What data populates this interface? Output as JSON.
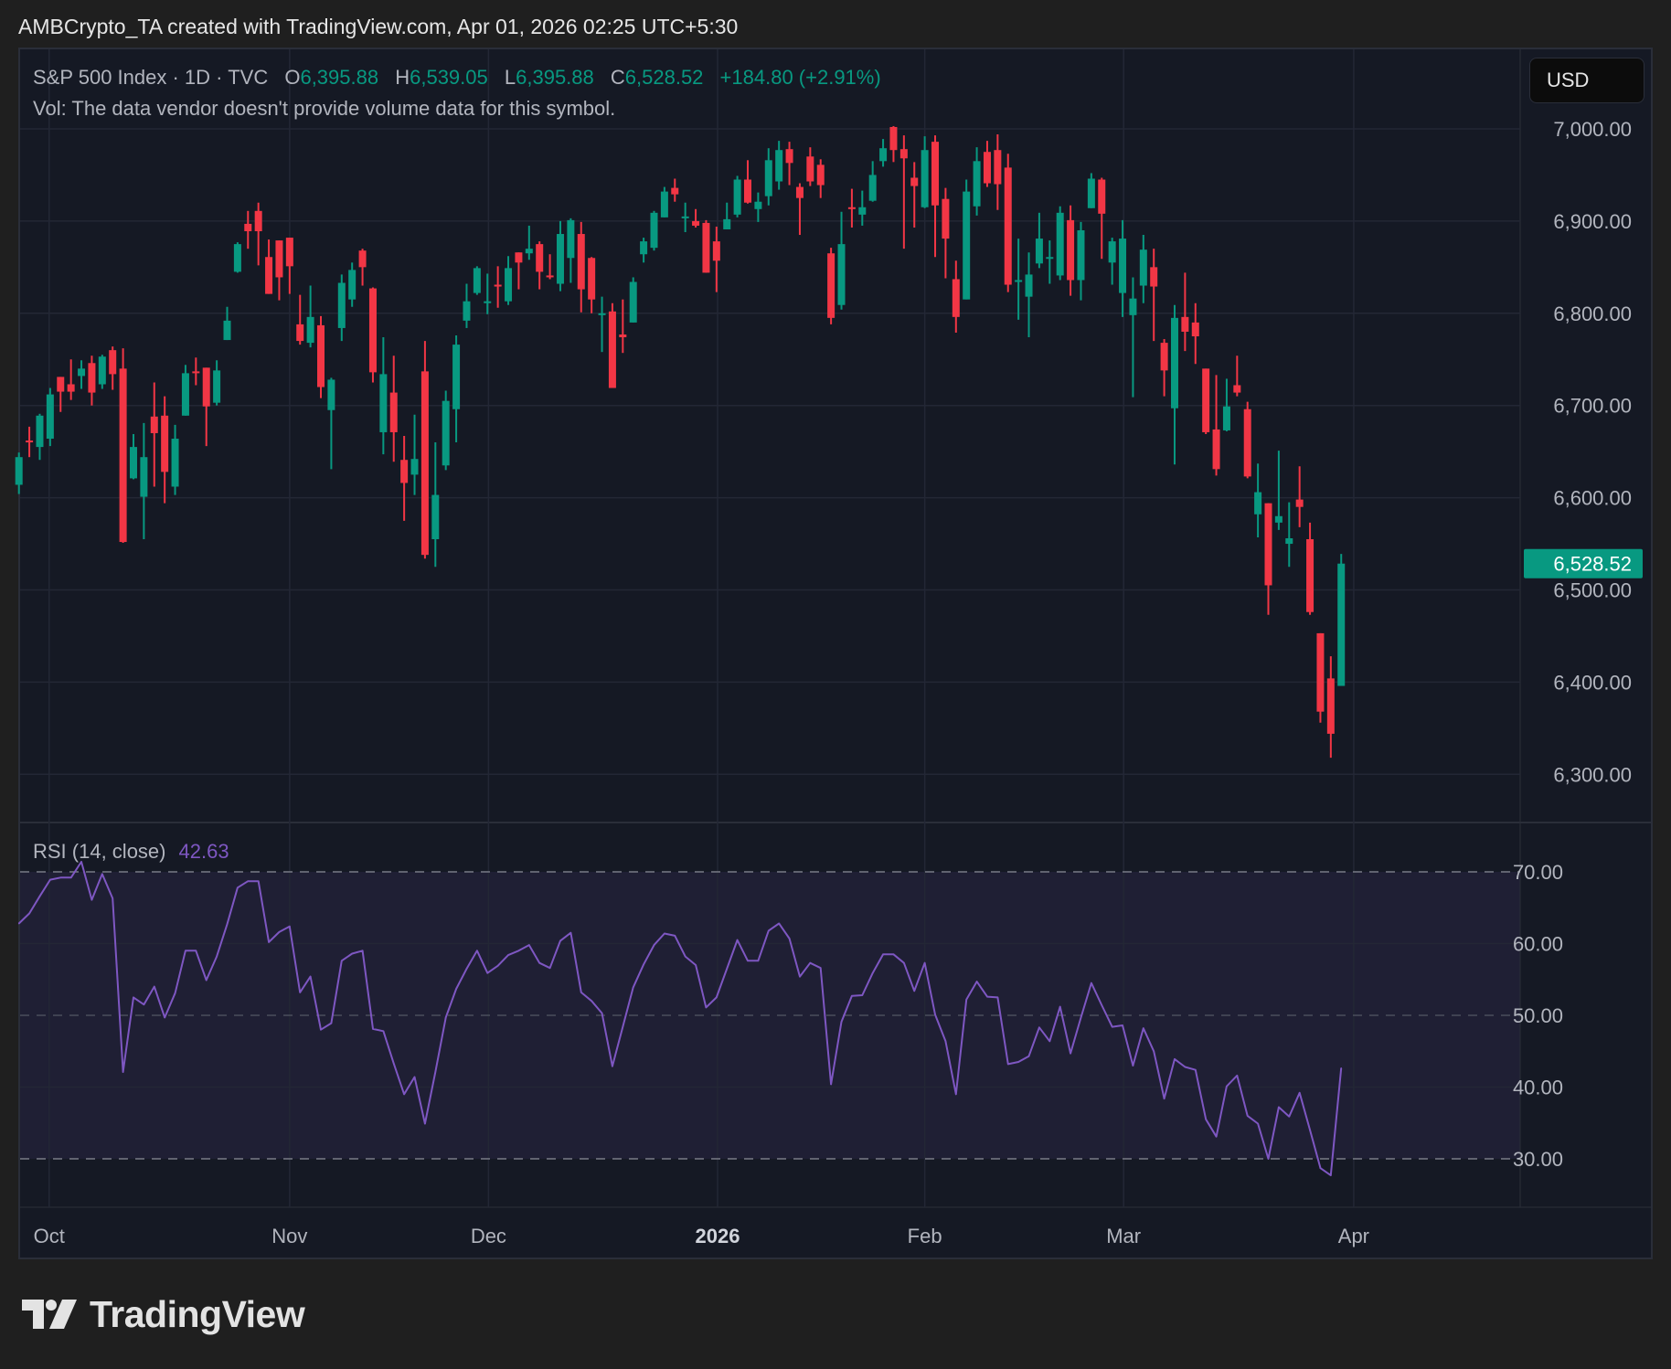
{
  "attribution": "AMBCrypto_TA created with TradingView.com, Apr 01, 2026 02:25 UTC+5:30",
  "legend": {
    "symbol": "S&P 500 Index · 1D · TVC",
    "o_label": "O",
    "o_value": "6,395.88",
    "h_label": "H",
    "h_value": "6,539.05",
    "l_label": "L",
    "l_value": "6,395.88",
    "c_label": "C",
    "c_value": "6,528.52",
    "change": "+184.80 (+2.91%)",
    "volume_note": "Vol: The data vendor doesn't provide volume data for this symbol."
  },
  "currency_button": "USD",
  "rsi_legend": {
    "label": "RSI (14, close)",
    "value": "42.63"
  },
  "logo_text": "TradingView",
  "colors": {
    "up": "#089981",
    "down": "#f23645",
    "rsi": "#7e57c2",
    "text": "#b2b5be",
    "grid": "#232735"
  },
  "chart_data": [
    {
      "type": "candlestick",
      "title": "S&P 500 Index · 1D · TVC",
      "ohlc_fields": [
        "open",
        "high",
        "low",
        "close"
      ],
      "ylim": [
        6250,
        7050
      ],
      "y_ticks": [
        7000,
        6900,
        6800,
        6700,
        6600,
        6500,
        6400,
        6300
      ],
      "y_tick_labels": [
        "7,000.00",
        "6,900.00",
        "6,800.00",
        "6,700.00",
        "6,600.00",
        "6,500.00",
        "6,400.00",
        "6,300.00"
      ],
      "last_price": 6528.52,
      "last_price_label": "6,528.52",
      "x_ticks": [
        {
          "label": "Oct",
          "at_bar": 2.9,
          "bold": false
        },
        {
          "label": "Nov",
          "at_bar": 26.0,
          "bold": false
        },
        {
          "label": "Dec",
          "at_bar": 45.1,
          "bold": false
        },
        {
          "label": "2026",
          "at_bar": 67.1,
          "bold": true
        },
        {
          "label": "Feb",
          "at_bar": 87.0,
          "bold": false
        },
        {
          "label": "Mar",
          "at_bar": 106.1,
          "bold": false
        },
        {
          "label": "Apr",
          "at_bar": 128.2,
          "bold": false
        }
      ],
      "candles": [
        [
          6614,
          6649,
          6604,
          6644
        ],
        [
          6662,
          6677,
          6644,
          6660
        ],
        [
          6655,
          6691,
          6641,
          6689
        ],
        [
          6664,
          6719,
          6656,
          6712
        ],
        [
          6731,
          6731,
          6693,
          6715
        ],
        [
          6723,
          6750,
          6706,
          6715
        ],
        [
          6732,
          6749,
          6718,
          6740
        ],
        [
          6746,
          6754,
          6700,
          6714
        ],
        [
          6723,
          6755,
          6718,
          6753
        ],
        [
          6760,
          6764,
          6717,
          6734
        ],
        [
          6740,
          6762,
          6551,
          6552
        ],
        [
          6621,
          6669,
          6620,
          6655
        ],
        [
          6601,
          6681,
          6555,
          6644
        ],
        [
          6688,
          6725,
          6612,
          6670
        ],
        [
          6689,
          6710,
          6594,
          6628
        ],
        [
          6612,
          6679,
          6603,
          6664
        ],
        [
          6689,
          6744,
          6689,
          6735
        ],
        [
          6737,
          6752,
          6722,
          6735
        ],
        [
          6741,
          6741,
          6656,
          6699
        ],
        [
          6703,
          6749,
          6700,
          6738
        ],
        [
          6771,
          6807,
          6771,
          6792
        ],
        [
          6845,
          6877,
          6844,
          6875
        ],
        [
          6897,
          6911,
          6870,
          6889
        ],
        [
          6911,
          6920,
          6852,
          6889
        ],
        [
          6861,
          6880,
          6821,
          6821
        ],
        [
          6879,
          6879,
          6814,
          6839
        ],
        [
          6882,
          6882,
          6821,
          6851
        ],
        [
          6788,
          6820,
          6766,
          6770
        ],
        [
          6768,
          6830,
          6763,
          6796
        ],
        [
          6787,
          6797,
          6708,
          6720
        ],
        [
          6695,
          6730,
          6631,
          6728
        ],
        [
          6784,
          6842,
          6770,
          6833
        ],
        [
          6815,
          6855,
          6807,
          6847
        ],
        [
          6868,
          6870,
          6830,
          6850
        ],
        [
          6827,
          6828,
          6725,
          6736
        ],
        [
          6671,
          6774,
          6647,
          6734
        ],
        [
          6714,
          6754,
          6639,
          6671
        ],
        [
          6641,
          6667,
          6575,
          6616
        ],
        [
          6625,
          6690,
          6603,
          6642
        ],
        [
          6737,
          6770,
          6534,
          6538
        ],
        [
          6555,
          6660,
          6525,
          6603
        ],
        [
          6635,
          6716,
          6630,
          6705
        ],
        [
          6696,
          6776,
          6660,
          6766
        ],
        [
          6792,
          6832,
          6784,
          6813
        ],
        [
          6822,
          6851,
          6820,
          6849
        ],
        [
          6811,
          6843,
          6799,
          6813
        ],
        [
          6831,
          6851,
          6806,
          6829
        ],
        [
          6813,
          6862,
          6809,
          6849
        ],
        [
          6866,
          6866,
          6826,
          6855
        ],
        [
          6865,
          6895,
          6858,
          6870
        ],
        [
          6875,
          6878,
          6826,
          6845
        ],
        [
          6841,
          6864,
          6837,
          6839
        ],
        [
          6832,
          6900,
          6824,
          6886
        ],
        [
          6860,
          6903,
          6833,
          6901
        ],
        [
          6886,
          6899,
          6801,
          6826
        ],
        [
          6860,
          6861,
          6800,
          6815
        ],
        [
          6798,
          6818,
          6758,
          6800
        ],
        [
          6802,
          6811,
          6719,
          6719
        ],
        [
          6777,
          6815,
          6757,
          6774
        ],
        [
          6790,
          6839,
          6790,
          6834
        ],
        [
          6864,
          6882,
          6855,
          6878
        ],
        [
          6871,
          6911,
          6868,
          6909
        ],
        [
          6904,
          6937,
          6904,
          6932
        ],
        [
          6936,
          6946,
          6921,
          6929
        ],
        [
          6903,
          6920,
          6888,
          6905
        ],
        [
          6900,
          6913,
          6893,
          6895
        ],
        [
          6898,
          6901,
          6844,
          6844
        ],
        [
          6878,
          6894,
          6823,
          6857
        ],
        [
          6891,
          6920,
          6891,
          6902
        ],
        [
          6907,
          6949,
          6904,
          6945
        ],
        [
          6945,
          6966,
          6919,
          6920
        ],
        [
          6913,
          6931,
          6899,
          6921
        ],
        [
          6927,
          6979,
          6917,
          6966
        ],
        [
          6943,
          6987,
          6934,
          6977
        ],
        [
          6978,
          6986,
          6939,
          6963
        ],
        [
          6937,
          6941,
          6885,
          6925
        ],
        [
          6970,
          6980,
          6938,
          6943
        ],
        [
          6961,
          6967,
          6925,
          6939
        ],
        [
          6865,
          6871,
          6788,
          6795
        ],
        [
          6809,
          6910,
          6804,
          6875
        ],
        [
          6915,
          6935,
          6893,
          6913
        ],
        [
          6907,
          6933,
          6895,
          6915
        ],
        [
          6922,
          6965,
          6921,
          6950
        ],
        [
          6965,
          6989,
          6959,
          6979
        ],
        [
          7002,
          7003,
          6964,
          6977
        ],
        [
          6978,
          6993,
          6870,
          6968
        ],
        [
          6947,
          6964,
          6893,
          6938
        ],
        [
          6915,
          6992,
          6914,
          6977
        ],
        [
          6986,
          6993,
          6861,
          6917
        ],
        [
          6924,
          6936,
          6838,
          6881
        ],
        [
          6837,
          6857,
          6779,
          6796
        ],
        [
          6815,
          6945,
          6815,
          6932
        ],
        [
          6916,
          6980,
          6906,
          6965
        ],
        [
          6975,
          6987,
          6937,
          6941
        ],
        [
          6977,
          6994,
          6912,
          6940
        ],
        [
          6958,
          6973,
          6823,
          6831
        ],
        [
          6834,
          6881,
          6793,
          6836
        ],
        [
          6818,
          6866,
          6774,
          6842
        ],
        [
          6854,
          6909,
          6849,
          6881
        ],
        [
          6860,
          6879,
          6832,
          6861
        ],
        [
          6841,
          6916,
          6836,
          6909
        ],
        [
          6901,
          6917,
          6819,
          6836
        ],
        [
          6836,
          6899,
          6814,
          6890
        ],
        [
          6914,
          6952,
          6914,
          6946
        ],
        [
          6945,
          6947,
          6859,
          6908
        ],
        [
          6855,
          6882,
          6831,
          6878
        ],
        [
          6822,
          6901,
          6796,
          6881
        ],
        [
          6798,
          6839,
          6709,
          6816
        ],
        [
          6830,
          6885,
          6811,
          6869
        ],
        [
          6850,
          6870,
          6770,
          6829
        ],
        [
          6768,
          6772,
          6710,
          6738
        ],
        [
          6697,
          6809,
          6636,
          6795
        ],
        [
          6796,
          6844,
          6759,
          6780
        ],
        [
          6790,
          6811,
          6745,
          6775
        ],
        [
          6740,
          6740,
          6669,
          6671
        ],
        [
          6674,
          6733,
          6624,
          6631
        ],
        [
          6673,
          6729,
          6672,
          6699
        ],
        [
          6722,
          6754,
          6710,
          6714
        ],
        [
          6696,
          6704,
          6621,
          6623
        ],
        [
          6582,
          6637,
          6557,
          6606
        ],
        [
          6594,
          6594,
          6473,
          6505
        ],
        [
          6573,
          6651,
          6565,
          6580
        ],
        [
          6550,
          6595,
          6525,
          6556
        ],
        [
          6598,
          6634,
          6568,
          6590
        ],
        [
          6555,
          6573,
          6473,
          6476
        ],
        [
          6453,
          6453,
          6356,
          6368
        ],
        [
          6404,
          6428,
          6318,
          6344
        ],
        [
          6395.88,
          6539.05,
          6395.88,
          6528.52
        ]
      ]
    },
    {
      "type": "line",
      "title": "RSI (14, close)",
      "ylim": [
        24,
        76
      ],
      "y_ticks": [
        70,
        60,
        50,
        40,
        30
      ],
      "y_tick_labels": [
        "70.00",
        "60.00",
        "50.00",
        "40.00",
        "30.00"
      ],
      "bands": {
        "upper": 70,
        "middle": 50,
        "lower": 30
      },
      "values": [
        62.8,
        64.2,
        66.6,
        68.9,
        69.2,
        69.2,
        71.4,
        66.1,
        69.7,
        66.3,
        42.1,
        52.5,
        51.5,
        54.0,
        49.7,
        53.1,
        59.0,
        59.0,
        54.9,
        58.2,
        62.7,
        67.8,
        68.7,
        68.7,
        60.2,
        61.6,
        62.4,
        53.2,
        55.4,
        48.0,
        48.9,
        57.6,
        58.6,
        59.0,
        48.1,
        47.8,
        43.3,
        39.0,
        41.4,
        34.9,
        42.1,
        49.7,
        53.7,
        56.5,
        59.0,
        55.9,
        56.9,
        58.4,
        59.0,
        59.8,
        57.3,
        56.6,
        60.4,
        61.5,
        53.2,
        52.0,
        50.3,
        42.9,
        48.4,
        53.9,
        57.1,
        59.8,
        61.4,
        61.1,
        58.2,
        57.0,
        51.1,
        52.5,
        56.5,
        60.5,
        57.6,
        57.6,
        61.8,
        62.8,
        60.7,
        55.4,
        57.3,
        56.6,
        40.4,
        49.1,
        52.7,
        52.8,
        55.9,
        58.5,
        58.5,
        57.3,
        53.4,
        57.3,
        50.1,
        46.4,
        39.0,
        52.2,
        54.7,
        52.6,
        52.5,
        43.2,
        43.5,
        44.3,
        48.3,
        46.4,
        51.2,
        44.7,
        49.7,
        54.5,
        51.4,
        48.4,
        48.6,
        43.0,
        48.2,
        45.0,
        38.4,
        43.9,
        42.8,
        42.4,
        35.5,
        33.1,
        40.1,
        41.6,
        36.0,
        34.9,
        30.0,
        37.2,
        35.9,
        39.2,
        34.0,
        28.7,
        27.7,
        42.63
      ]
    }
  ]
}
